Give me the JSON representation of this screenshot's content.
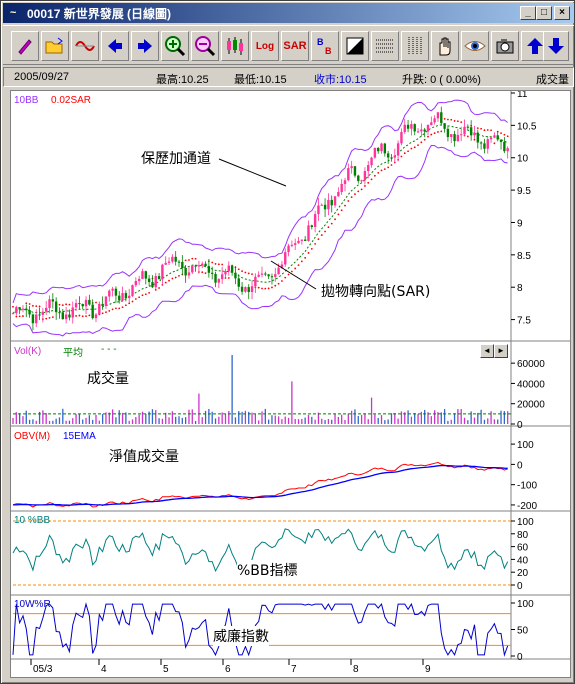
{
  "window": {
    "title": "00017  新世界發展  (日線圖)",
    "app_icon": "~"
  },
  "toolbar": {
    "icons": [
      "pencil-icon",
      "open-folder-icon",
      "wave-line-icon",
      "arrow-left-icon",
      "arrow-right-icon",
      "zoom-in-icon",
      "zoom-out-icon",
      "candlestick-icon",
      "log-scale-icon",
      "sar-icon",
      "bb-icon",
      "contrast-icon",
      "grid-horizontal-icon",
      "grid-vertical-icon",
      "hand-icon",
      "eye-icon",
      "camera-icon",
      "arrow-up-icon",
      "arrow-down-icon"
    ],
    "sar_label": "SAR",
    "log_label": "Log",
    "bb_label": "B\nB"
  },
  "info": {
    "date": "2005/09/27",
    "high": "最高:10.25",
    "low": "最低:10.15",
    "close": "收市:10.15",
    "change": "升跌: 0 ( 0.00%)",
    "volume_label": "成交量"
  },
  "panels": {
    "price": {
      "bb_label": "10BB",
      "sar_label": "0.02SAR",
      "ticks": [
        "11",
        "10.5",
        "10",
        "9.5",
        "9",
        "8.5",
        "8",
        "7.5"
      ]
    },
    "volume": {
      "vol_label": "Vol(K)",
      "avg_label": "平均",
      "ticks": [
        "60000",
        "40000",
        "20000",
        "0"
      ]
    },
    "obv": {
      "obv_label": "OBV(M)",
      "ema_label": "15EMA",
      "ticks": [
        "100",
        "0",
        "-100",
        "-200"
      ]
    },
    "pctbb": {
      "label": "10 %BB",
      "ticks": [
        "100",
        "80",
        "60",
        "40",
        "20",
        "0"
      ]
    },
    "wr": {
      "label": "10W%R",
      "ticks": [
        "100",
        "50",
        "0"
      ]
    }
  },
  "annotations": {
    "bb_channel": "保歷加通道",
    "sar_turn": "拋物轉向點(SAR)",
    "volume": "成交量",
    "obv": "淨值成交量",
    "pctbb": "%BB指標",
    "wr": "威廉指數"
  },
  "x_axis": {
    "labels": [
      "05/3",
      "4",
      "5",
      "6",
      "7",
      "8",
      "9"
    ]
  },
  "colors": {
    "up": "#ff3399",
    "down": "#008000",
    "bb": "#9933ff",
    "sar": "#ff0000",
    "ma": "#008000",
    "obv": "#ff0000",
    "ema": "#0000ff",
    "osc": "#008080",
    "wr": "#0000cc",
    "level": "#ff8800"
  },
  "chart_data": {
    "type": "line",
    "title": "00017 新世界發展 (日線圖)",
    "x": [
      "05/3",
      "4",
      "5",
      "6",
      "7",
      "8",
      "9"
    ],
    "series": [
      {
        "name": "10BB",
        "values": [
          7.6,
          7.7,
          8.4,
          8.0,
          9.6,
          10.6,
          10.15
        ]
      },
      {
        "name": "0.02SAR",
        "values": [
          7.5,
          7.6,
          8.2,
          8.3,
          8.7,
          10.3,
          10.0
        ]
      }
    ],
    "ylim": [
      7.2,
      11
    ]
  }
}
